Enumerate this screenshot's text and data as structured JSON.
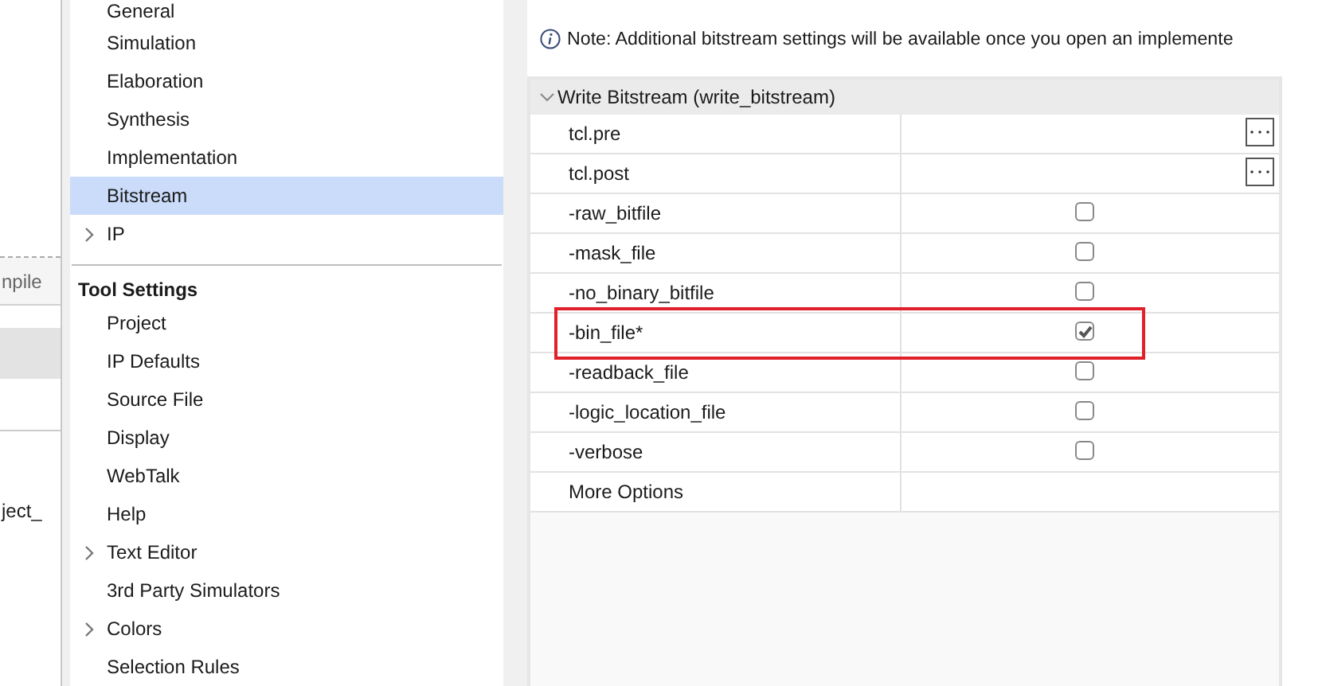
{
  "background_pane": {
    "fragments": [
      "npile",
      "ject_"
    ]
  },
  "nav": {
    "sections": [
      {
        "items": [
          {
            "label": "General",
            "selected": false
          },
          {
            "label": "Simulation",
            "selected": false
          },
          {
            "label": "Elaboration",
            "selected": false
          },
          {
            "label": "Synthesis",
            "selected": false
          },
          {
            "label": "Implementation",
            "selected": false
          },
          {
            "label": "Bitstream",
            "selected": true
          },
          {
            "label": "IP",
            "selected": false,
            "expanded": false
          }
        ]
      },
      {
        "title": "Tool Settings",
        "items": [
          {
            "label": "Project",
            "selected": false
          },
          {
            "label": "IP Defaults",
            "selected": false
          },
          {
            "label": "Source File",
            "selected": false
          },
          {
            "label": "Display",
            "selected": false
          },
          {
            "label": "WebTalk",
            "selected": false
          },
          {
            "label": "Help",
            "selected": false
          },
          {
            "label": "Text Editor",
            "selected": false,
            "expanded": false
          },
          {
            "label": "3rd Party Simulators",
            "selected": false
          },
          {
            "label": "Colors",
            "selected": false,
            "expanded": false
          },
          {
            "label": "Selection Rules",
            "selected": false
          }
        ]
      }
    ]
  },
  "note": "Note: Additional bitstream settings will be available once you open an implemente",
  "table": {
    "group": {
      "title": "Write Bitstream (write_bitstream)",
      "expanded": true
    },
    "rows": [
      {
        "name": "tcl.pre",
        "kind": "file",
        "highlighted": false
      },
      {
        "name": "tcl.post",
        "kind": "file",
        "highlighted": false
      },
      {
        "name": "-raw_bitfile",
        "kind": "checkbox",
        "checked": false,
        "highlighted": false
      },
      {
        "name": "-mask_file",
        "kind": "checkbox",
        "checked": false,
        "highlighted": false
      },
      {
        "name": "-no_binary_bitfile",
        "kind": "checkbox",
        "checked": false,
        "highlighted": false
      },
      {
        "name": "-bin_file*",
        "kind": "checkbox",
        "checked": true,
        "highlighted": true
      },
      {
        "name": "-readback_file",
        "kind": "checkbox",
        "checked": false,
        "highlighted": false
      },
      {
        "name": "-logic_location_file",
        "kind": "checkbox",
        "checked": false,
        "highlighted": false
      },
      {
        "name": "-verbose",
        "kind": "checkbox",
        "checked": false,
        "highlighted": false
      },
      {
        "name": "More Options",
        "kind": "text",
        "highlighted": false
      }
    ]
  }
}
